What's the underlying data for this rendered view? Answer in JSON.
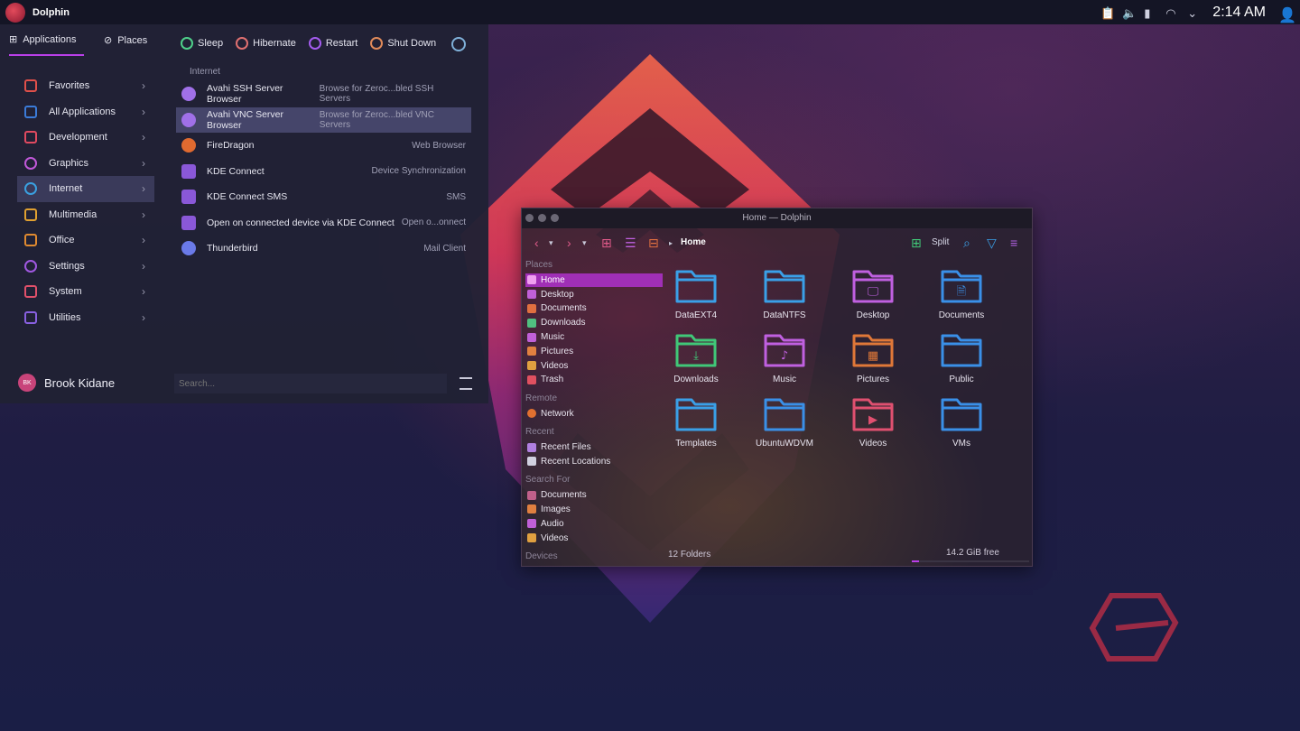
{
  "panel": {
    "app_title": "Dolphin",
    "clock": "2:14 AM"
  },
  "launcher": {
    "tabs": [
      {
        "label": "Applications",
        "icon": "apps-grid-icon"
      },
      {
        "label": "Places",
        "icon": "compass-icon"
      }
    ],
    "power": [
      {
        "label": "Sleep",
        "color": "#4fd08a"
      },
      {
        "label": "Hibernate",
        "color": "#e07070"
      },
      {
        "label": "Restart",
        "color": "#a55cf0"
      },
      {
        "label": "Shut Down",
        "color": "#e08a5a"
      }
    ],
    "categories": [
      {
        "label": "Favorites",
        "color": "#e0504a"
      },
      {
        "label": "All Applications",
        "color": "#3b7bd8"
      },
      {
        "label": "Development",
        "color": "#e04a60"
      },
      {
        "label": "Graphics",
        "color": "#c058d8"
      },
      {
        "label": "Internet",
        "color": "#3aa0e0"
      },
      {
        "label": "Multimedia",
        "color": "#e0a030"
      },
      {
        "label": "Office",
        "color": "#e08a30"
      },
      {
        "label": "Settings",
        "color": "#a058e0"
      },
      {
        "label": "System",
        "color": "#e0506a"
      },
      {
        "label": "Utilities",
        "color": "#8860e0"
      }
    ],
    "section_title": "Internet",
    "apps": [
      {
        "name": "Avahi SSH Server Browser",
        "desc": "Browse for Zeroc...bled SSH Servers",
        "color": "#a070e8"
      },
      {
        "name": "Avahi VNC Server Browser",
        "desc": "Browse for Zeroc...bled VNC Servers",
        "color": "#a070e8"
      },
      {
        "name": "FireDragon",
        "desc": "Web Browser",
        "color": "#e06a30"
      },
      {
        "name": "KDE Connect",
        "desc": "Device Synchronization",
        "color": "#8a58d8"
      },
      {
        "name": "KDE Connect SMS",
        "desc": "SMS",
        "color": "#8a58d8"
      },
      {
        "name": "Open on connected device via KDE Connect",
        "desc": "Open o...onnect",
        "color": "#8a58d8"
      },
      {
        "name": "Thunderbird",
        "desc": "Mail Client",
        "color": "#6a7ae8"
      }
    ],
    "user": {
      "initials": "BK",
      "name": "Brook Kidane"
    },
    "search_placeholder": "Search..."
  },
  "dolphin": {
    "window_title": "Home — Dolphin",
    "breadcrumb": "Home",
    "split_label": "Split",
    "places_heads": {
      "places": "Places",
      "remote": "Remote",
      "recent": "Recent",
      "search": "Search For",
      "devices": "Devices"
    },
    "places": [
      {
        "label": "Home",
        "color": "#f0a0f0"
      },
      {
        "label": "Desktop",
        "color": "#c060d8"
      },
      {
        "label": "Documents",
        "color": "#e07040"
      },
      {
        "label": "Downloads",
        "color": "#50c080"
      }
    ],
    "places2": [
      {
        "label": "Music",
        "color": "#c060d8"
      },
      {
        "label": "Pictures",
        "color": "#e08040"
      },
      {
        "label": "Videos",
        "color": "#e0a040"
      },
      {
        "label": "Trash",
        "color": "#e05060"
      }
    ],
    "remote": [
      {
        "label": "Network",
        "color": "#e07030"
      }
    ],
    "recent": [
      {
        "label": "Recent Files",
        "color": "#b080e0"
      },
      {
        "label": "Recent Locations",
        "color": "#d0d0e0"
      }
    ],
    "search": [
      {
        "label": "Documents",
        "color": "#c0608a"
      },
      {
        "label": "Images",
        "color": "#e08040"
      },
      {
        "label": "Audio",
        "color": "#c060d8"
      },
      {
        "label": "Videos",
        "color": "#e0a040"
      }
    ],
    "folders": [
      {
        "label": "DataEXT4",
        "color": "#3aa0e8",
        "glyph": ""
      },
      {
        "label": "DataNTFS",
        "color": "#3aa0e8",
        "glyph": ""
      },
      {
        "label": "Desktop",
        "color": "#c060e0",
        "glyph": "🖵"
      },
      {
        "label": "Documents",
        "color": "#3a90e8",
        "glyph": "🗎"
      },
      {
        "label": "Downloads",
        "color": "#40c878",
        "glyph": "⤓"
      },
      {
        "label": "Music",
        "color": "#c060e0",
        "glyph": "♪"
      },
      {
        "label": "Pictures",
        "color": "#e07838",
        "glyph": "▦"
      },
      {
        "label": "Public",
        "color": "#3a90e8",
        "glyph": ""
      },
      {
        "label": "Templates",
        "color": "#3aa0e8",
        "glyph": ""
      },
      {
        "label": "UbuntuWDVM",
        "color": "#3a90e8",
        "glyph": ""
      },
      {
        "label": "Videos",
        "color": "#e05070",
        "glyph": "▶"
      },
      {
        "label": "VMs",
        "color": "#3a90e8",
        "glyph": ""
      }
    ],
    "status_count": "12 Folders",
    "free_space": "14.2 GiB free",
    "free_fraction": 0.06
  }
}
